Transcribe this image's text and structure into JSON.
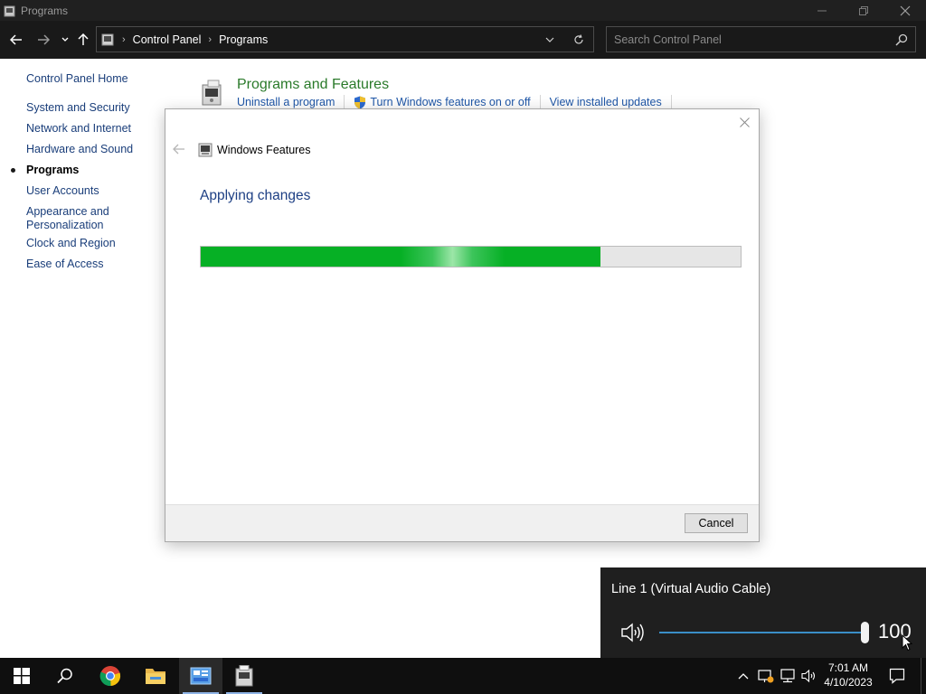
{
  "window": {
    "title": "Programs"
  },
  "address": {
    "crumbs": [
      "Control Panel",
      "Programs"
    ],
    "search_placeholder": "Search Control Panel"
  },
  "leftnav": {
    "home": "Control Panel Home",
    "items": [
      {
        "label": "System and Security",
        "active": false
      },
      {
        "label": "Network and Internet",
        "active": false
      },
      {
        "label": "Hardware and Sound",
        "active": false
      },
      {
        "label": "Programs",
        "active": true
      },
      {
        "label": "User Accounts",
        "active": false
      },
      {
        "label": "Appearance and Personalization",
        "active": false
      },
      {
        "label": "Clock and Region",
        "active": false
      },
      {
        "label": "Ease of Access",
        "active": false
      }
    ]
  },
  "programs_features": {
    "title": "Programs and Features",
    "links": [
      "Uninstall a program",
      "Turn Windows features on or off",
      "View installed updates"
    ]
  },
  "dialog": {
    "title": "Windows Features",
    "heading": "Applying changes",
    "progress": 0.74,
    "cancel_label": "Cancel"
  },
  "volume": {
    "device": "Line 1 (Virtual Audio Cable)",
    "level": 100,
    "level_text": "100"
  },
  "taskbar": {
    "apps": [
      "start-icon",
      "search-icon",
      "chrome-icon",
      "file-explorer-icon",
      "control-panel-icon",
      "windows-features-icon"
    ]
  },
  "clock": {
    "time": "7:01 AM",
    "date": "4/10/2023"
  },
  "colors": {
    "progress_green": "#06b025",
    "link_blue": "#1f57a8",
    "heading_blue": "#1d3f84",
    "title_green": "#2a7a2a"
  }
}
